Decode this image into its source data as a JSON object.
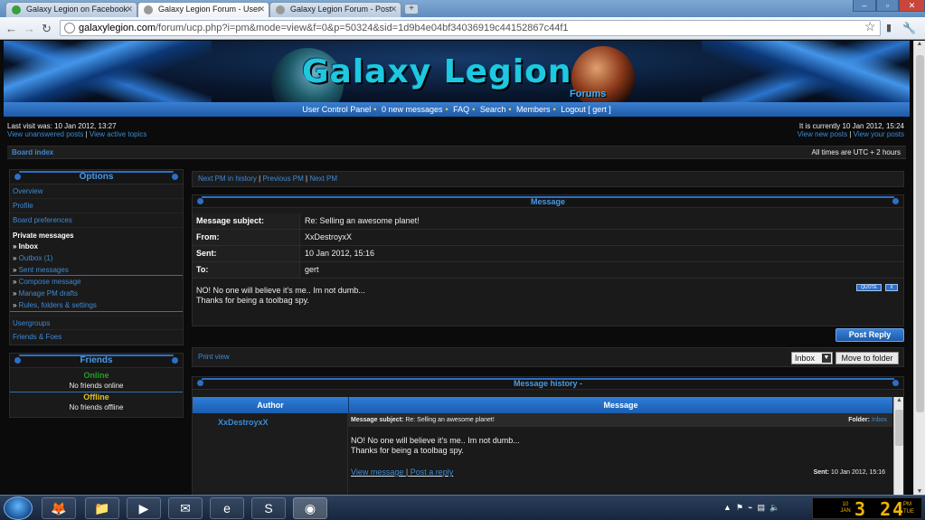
{
  "browser": {
    "tabs": [
      {
        "label": "Galaxy Legion on Facebook"
      },
      {
        "label": "Galaxy Legion Forum - User"
      },
      {
        "label": "Galaxy Legion Forum - Post"
      }
    ],
    "url_host": "galaxylegion.com",
    "url_path": "/forum/ucp.php?i=pm&mode=view&f=0&p=50324&sid=1d9b4e04bf34036919c44152867c44f1"
  },
  "banner": {
    "logo": "Galaxy Legion",
    "logo_sub": "Forums"
  },
  "nav": {
    "items": [
      "User Control Panel",
      "0 new messages",
      "FAQ",
      "Search",
      "Members",
      "Logout [ gert ]"
    ]
  },
  "info": {
    "last_visit": "Last visit was: 10 Jan 2012, 13:27",
    "unanswered": "View unanswered posts",
    "active": "View active topics",
    "current_time": "It is currently 10 Jan 2012, 15:24",
    "new_posts": "View new posts",
    "your_posts": "View your posts"
  },
  "breadcrumb": {
    "board_index": "Board index",
    "timezone": "All times are UTC + 2 hours"
  },
  "sidebar": {
    "options_title": "Options",
    "items": [
      "Overview",
      "Profile",
      "Board preferences"
    ],
    "pm_label": "Private messages",
    "pm_items": [
      "Inbox",
      "Outbox (1)",
      "Sent messages",
      "Compose message",
      "Manage PM drafts",
      "Rules, folders & settings"
    ],
    "lower_items": [
      "Usergroups",
      "Friends & Foes"
    ],
    "friends_title": "Friends",
    "online_label": "Online",
    "online_text": "No friends online",
    "offline_label": "Offline",
    "offline_text": "No friends offline"
  },
  "pmnav": {
    "next": "Next PM in history",
    "prev": "Previous PM",
    "nextpm": "Next PM"
  },
  "message": {
    "title": "Message",
    "subject_label": "Message subject:",
    "subject": "Re: Selling an awesome planet!",
    "from_label": "From:",
    "from": "XxDestroyxX",
    "sent_label": "Sent:",
    "sent": "10 Jan 2012, 15:16",
    "to_label": "To:",
    "to": "gert",
    "body_line1": "NO! No one will believe it's me.. Im not dumb...",
    "body_line2": "Thanks for being a toolbag spy.",
    "quote_btn": "QUOTE",
    "x_btn": "X"
  },
  "actions": {
    "post_reply": "Post Reply",
    "print_view": "Print view",
    "folder_value": "Inbox",
    "move_btn": "Move to folder"
  },
  "history": {
    "title": "Message history -",
    "col_author": "Author",
    "col_message": "Message",
    "author": "XxDestroyxX",
    "subject_label": "Message subject:",
    "subject": "Re: Selling an awesome planet!",
    "folder_label": "Folder:",
    "folder": "Inbox",
    "body_line1": "NO! No one will believe it's me.. Im not dumb...",
    "body_line2": "Thanks for being a toolbag spy.",
    "view_message": "View message",
    "post_reply": "Post a reply",
    "sent_label": "Sent:",
    "sent": "10 Jan 2012, 15:16"
  },
  "taskbar": {
    "clock_date": "10 JAN",
    "clock_time": "3 24",
    "clock_ampm": "PM",
    "clock_day": "TUE"
  }
}
